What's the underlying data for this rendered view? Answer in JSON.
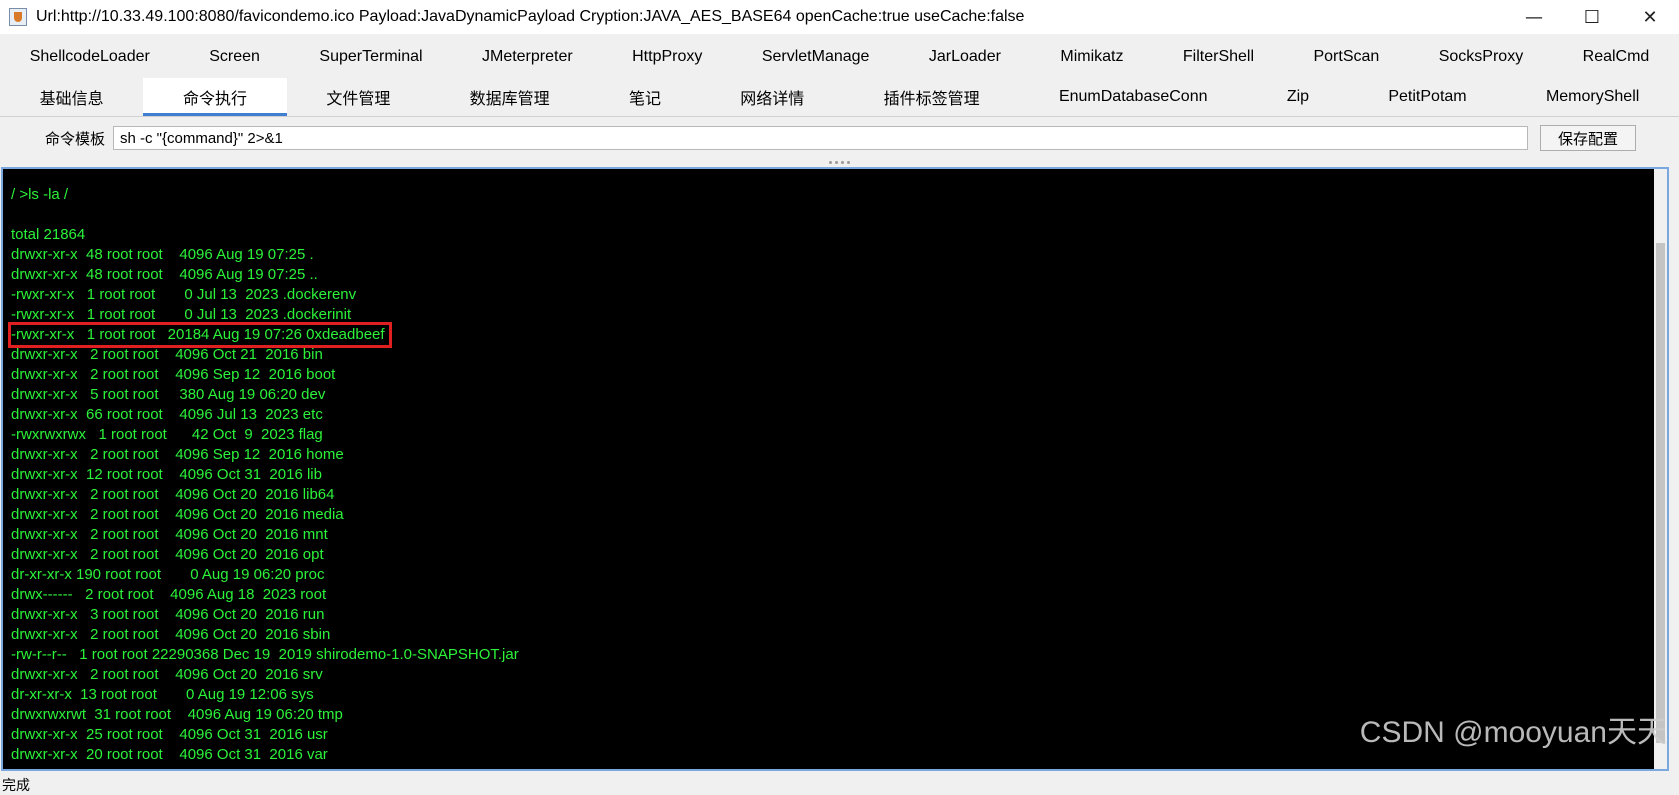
{
  "window": {
    "title": "Url:http://10.33.49.100:8080/favicondemo.ico Payload:JavaDynamicPayload Cryption:JAVA_AES_BASE64 openCache:true useCache:false",
    "app_icon": "java-cup-icon",
    "controls": {
      "minimize": "—",
      "maximize": "☐",
      "close": "✕"
    }
  },
  "tabs_row1": [
    "ShellcodeLoader",
    "Screen",
    "SuperTerminal",
    "JMeterpreter",
    "HttpProxy",
    "ServletManage",
    "JarLoader",
    "Mimikatz",
    "FilterShell",
    "PortScan",
    "SocksProxy",
    "RealCmd"
  ],
  "tabs_row2": [
    "基础信息",
    "命令执行",
    "文件管理",
    "数据库管理",
    "笔记",
    "网络详情",
    "插件标签管理",
    "EnumDatabaseConn",
    "Zip",
    "PetitPotam",
    "MemoryShell"
  ],
  "active_tab": "命令执行",
  "command_template": {
    "label": "命令模板",
    "value": "sh -c \"{command}\" 2>&1",
    "save_button": "保存配置"
  },
  "console": {
    "text_color": "#2cf23a",
    "highlight_color": "#e02020",
    "lines": [
      "/ >ls -la /",
      "",
      "total 21864",
      "drwxr-xr-x  48 root root    4096 Aug 19 07:25 .",
      "drwxr-xr-x  48 root root    4096 Aug 19 07:25 ..",
      "-rwxr-xr-x   1 root root       0 Jul 13  2023 .dockerenv",
      "-rwxr-xr-x   1 root root       0 Jul 13  2023 .dockerinit",
      "-rwxr-xr-x   1 root root   20184 Aug 19 07:26 0xdeadbeef",
      "drwxr-xr-x   2 root root    4096 Oct 21  2016 bin",
      "drwxr-xr-x   2 root root    4096 Sep 12  2016 boot",
      "drwxr-xr-x   5 root root     380 Aug 19 06:20 dev",
      "drwxr-xr-x  66 root root    4096 Jul 13  2023 etc",
      "-rwxrwxrwx   1 root root      42 Oct  9  2023 flag",
      "drwxr-xr-x   2 root root    4096 Sep 12  2016 home",
      "drwxr-xr-x  12 root root    4096 Oct 31  2016 lib",
      "drwxr-xr-x   2 root root    4096 Oct 20  2016 lib64",
      "drwxr-xr-x   2 root root    4096 Oct 20  2016 media",
      "drwxr-xr-x   2 root root    4096 Oct 20  2016 mnt",
      "drwxr-xr-x   2 root root    4096 Oct 20  2016 opt",
      "dr-xr-xr-x 190 root root       0 Aug 19 06:20 proc",
      "drwx------   2 root root    4096 Aug 18  2023 root",
      "drwxr-xr-x   3 root root    4096 Oct 20  2016 run",
      "drwxr-xr-x   2 root root    4096 Oct 20  2016 sbin",
      "-rw-r--r--   1 root root 22290368 Dec 19  2019 shirodemo-1.0-SNAPSHOT.jar",
      "drwxr-xr-x   2 root root    4096 Oct 20  2016 srv",
      "dr-xr-xr-x  13 root root       0 Aug 19 12:06 sys",
      "drwxrwxrwt  31 root root    4096 Aug 19 06:20 tmp",
      "drwxr-xr-x  25 root root    4096 Oct 31  2016 usr",
      "drwxr-xr-x  20 root root    4096 Oct 31  2016 var"
    ]
  },
  "watermark": "CSDN @mooyuan天天",
  "status": "完成"
}
